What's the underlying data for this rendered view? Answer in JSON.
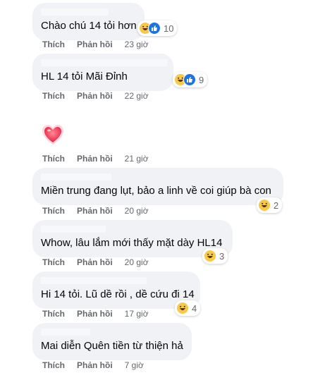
{
  "comments": [
    {
      "text": "Chào chú 14 tỏi hơn",
      "reactions": [
        "haha",
        "like"
      ],
      "count": "10",
      "like_label": "Thích",
      "reply_label": "Phản hồi",
      "time": "23 giờ"
    },
    {
      "text": "HL 14 tỏi Mãi Đỉnh",
      "reactions": [
        "haha",
        "like"
      ],
      "count": "9",
      "like_label": "Thích",
      "reply_label": "Phản hồi",
      "time": "22 giờ"
    },
    {
      "text": "",
      "sticker": "heart",
      "like_label": "Thích",
      "reply_label": "Phản hồi",
      "time": "21 giờ"
    },
    {
      "text": "Miền trung đang lụt, bảo a linh về coi giúp bà con",
      "reactions": [
        "haha"
      ],
      "count": "2",
      "like_label": "Thích",
      "reply_label": "Phản hồi",
      "time": "20 giờ"
    },
    {
      "text": "Whow, lâu lắm mới thấy mặt dày HL14",
      "reactions": [
        "haha"
      ],
      "count": "3",
      "like_label": "Thích",
      "reply_label": "Phản hồi",
      "time": "20 giờ"
    },
    {
      "text": "Hi 14 tỏi. Lũ dề rồi , dề cứu đi 14",
      "reactions": [
        "haha"
      ],
      "count": "4",
      "like_label": "Thích",
      "reply_label": "Phản hồi",
      "time": "17 giờ"
    },
    {
      "text": "Mai diễn Quên tiền từ thiện hả",
      "like_label": "Thích",
      "reply_label": "Phản hồi",
      "time": "7 giờ"
    }
  ],
  "colors": {
    "bubble": "#f0f2f5",
    "meta": "#65676b",
    "haha": "#f7c94a",
    "like": "#1b74e4",
    "heart": "#f0384f"
  }
}
